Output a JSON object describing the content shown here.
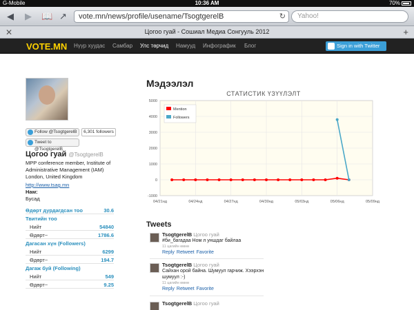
{
  "status_bar": {
    "carrier": "G-Mobile",
    "time": "10:36 AM",
    "battery": "70%"
  },
  "browser": {
    "url": "vote.mn/news/profile/usename/TsogtgerelB",
    "search_placeholder": "Yahoo!",
    "tab_title": "Цогоо гуай - Сошиал Медиа Сонгууль 2012",
    "icons": [
      "back-icon",
      "forward-icon",
      "bookmarks-icon",
      "share-icon",
      "reload-icon",
      "close-icon",
      "add-tab-icon"
    ]
  },
  "site_nav": {
    "logo": "VOTE.MN",
    "items": [
      {
        "label": "Нүүр хуудас",
        "active": false
      },
      {
        "label": "Самбар",
        "active": false
      },
      {
        "label": "Улс төрчид",
        "active": true
      },
      {
        "label": "Намууд",
        "active": false
      },
      {
        "label": "Инфографик",
        "active": false
      },
      {
        "label": "Блог",
        "active": false
      }
    ],
    "signin_label": "Sign in with Twitter"
  },
  "profile": {
    "follow_label": "Follow @TsogtgerelB",
    "followers_label": "6,301 followers",
    "tweet_to_label": "Tweet to @TsogtgerelB",
    "name": "Цогоо гуай",
    "handle": "@TsogtgerelB",
    "bio": "MPP conference member, Institute of Administrative Management (IAM) London, United Kingdom",
    "link": "http://www.tsag.mn",
    "party_label": "Нам:",
    "party_value": "Бусад"
  },
  "stats": {
    "daily_avg_label": "Өдөрт дурдагдсан тоо",
    "daily_avg_value": "30.6",
    "tweets_heading": "Твитийн тоо",
    "tweets_total_label": "Нийт",
    "tweets_total": "54840",
    "tweets_daily_label": "Өдөрт~",
    "tweets_daily": "1786.6",
    "followers_heading": "Дагасан хүн (Followers)",
    "followers_total_label": "Нийт",
    "followers_total": "6299",
    "followers_daily_label": "Өдөрт~",
    "followers_daily": "194.7",
    "following_heading": "Дагаж буй (Following)",
    "following_total_label": "Нийт",
    "following_total": "549",
    "following_daily_label": "Өдөрт~",
    "following_daily": "9.25"
  },
  "main": {
    "section_title": "Мэдээлэл",
    "chart_title": "СТАТИСТИК ҮЗҮҮЛЭЛТ",
    "tweets_title": "Tweets"
  },
  "chart_data": {
    "type": "line",
    "title": "СТАТИСТИК ҮЗҮҮЛЭЛТ",
    "xlabel": "",
    "ylabel": "",
    "x_ticks": [
      "04/21нд",
      "04/24нд",
      "04/27нд",
      "04/30нд",
      "05/03нд",
      "05/06нд",
      "05/09нд"
    ],
    "ylim": [
      -1000,
      5000
    ],
    "y_ticks": [
      -1000,
      0,
      1000,
      2000,
      3000,
      4000,
      5000
    ],
    "grid": true,
    "legend_position": "top-left",
    "series": [
      {
        "name": "Mention",
        "color": "#ff0000",
        "x": [
          "04/22",
          "04/23",
          "04/24",
          "04/25",
          "04/26",
          "04/27",
          "04/28",
          "04/29",
          "04/30",
          "05/01",
          "05/02",
          "05/03",
          "05/04",
          "05/05",
          "05/06",
          "05/07"
        ],
        "values": [
          0,
          0,
          0,
          0,
          0,
          0,
          0,
          0,
          0,
          0,
          0,
          0,
          0,
          0,
          100,
          0
        ]
      },
      {
        "name": "Followers",
        "color": "#4aa8c8",
        "x": [
          "05/06",
          "05/07"
        ],
        "values": [
          3800,
          0
        ]
      }
    ]
  },
  "tweets": [
    {
      "user": "TsogtgerelB",
      "name": "Цогоо гуай",
      "text": "#би_багадаа Ном л уншдаг байлаа",
      "time": "11 цагийн өмнө",
      "actions": [
        "Reply",
        "Retweet",
        "Favorite"
      ]
    },
    {
      "user": "TsogtgerelB",
      "name": "Цогоо гуай",
      "text": "Сайхан орой байна. Шумуул гарчиж. Хээрхэн шумуул :-)",
      "time": "11 цагийн өмнө",
      "actions": [
        "Reply",
        "Retweet",
        "Favorite"
      ]
    },
    {
      "user": "TsogtgerelB",
      "name": "Цогоо гуай",
      "text": "",
      "time": "",
      "actions": []
    }
  ]
}
